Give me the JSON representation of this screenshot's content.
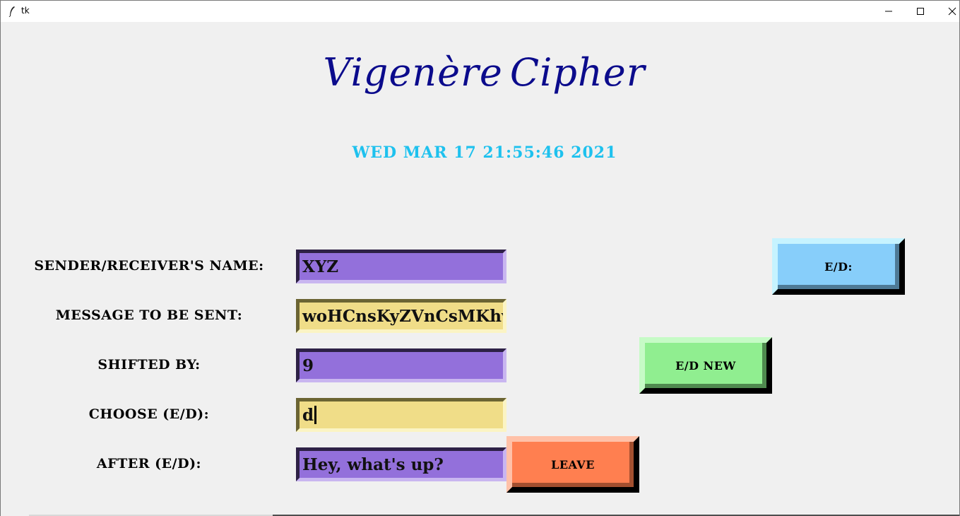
{
  "window": {
    "title": "tk",
    "controls": {
      "minimize": "—",
      "maximize": "☐",
      "close": "✕"
    }
  },
  "header": {
    "title_part1": "Vigenère",
    "title_part2": "Cipher",
    "datetime": "WED MAR 17 21:55:46 2021"
  },
  "form": {
    "name_label": "SENDER/RECEIVER'S NAME:",
    "name_value": "XYZ",
    "message_label": "MESSAGE TO BE SENT:",
    "message_value": "woHCnsKyZVnCsMKhv",
    "shift_label": "SHIFTED BY:",
    "shift_value": "9",
    "mode_label": "CHOOSE (E/D):",
    "mode_value": "d",
    "result_label": "AFTER (E/D):",
    "result_value": "Hey, what's up?"
  },
  "buttons": {
    "ed": "E/D:",
    "ed_new": "E/D NEW",
    "leave": "LEAVE"
  },
  "colors": {
    "title": "#0b0b8c",
    "datetime": "#1ec1ee",
    "entry_purple": "#9370db",
    "entry_yellow": "#f0dd88",
    "btn_ed": "#87cefa",
    "btn_ednew": "#90ee90",
    "btn_leave": "#ff7f50"
  }
}
